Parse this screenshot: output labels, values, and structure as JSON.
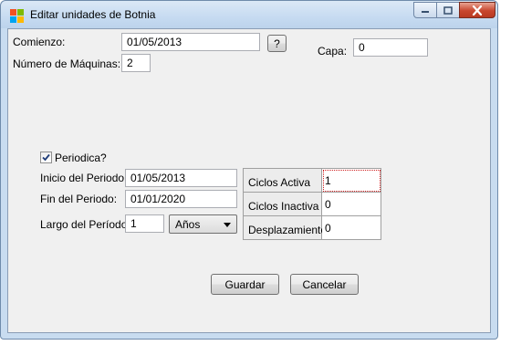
{
  "window": {
    "title": "Editar unidades de Botnia",
    "icon": "app-windows-icon",
    "controls": {
      "minimize": "minimize-icon",
      "maximize": "maximize-icon",
      "close": "close-icon"
    },
    "colors": {
      "close": "#c8462e",
      "titlebar": "#c6dbf1",
      "client": "#f0f0f0"
    }
  },
  "form": {
    "comienzo_label": "Comienzo:",
    "comienzo_value": "01/05/2013",
    "help_button": "?",
    "capa_label": "Capa:",
    "capa_value": "0",
    "maquinas_label": "Número de Máquinas:",
    "maquinas_value": "2"
  },
  "periodic": {
    "checkbox_label": "Periodica?",
    "checked": true,
    "inicio_label": "Inicio del Periodo:",
    "inicio_value": "01/05/2013",
    "fin_label": "Fin del Periodo:",
    "fin_value": "01/01/2020",
    "largo_label": "Largo del Período:",
    "largo_value": "1",
    "unit_selected": "Años"
  },
  "grid": {
    "rows": [
      {
        "header": "Ciclos Activa",
        "value": "1"
      },
      {
        "header": "Ciclos Inactiva",
        "value": "0"
      },
      {
        "header": "Desplazamiento",
        "value": "0"
      }
    ]
  },
  "actions": {
    "save_label": "Guardar",
    "cancel_label": "Cancelar"
  }
}
